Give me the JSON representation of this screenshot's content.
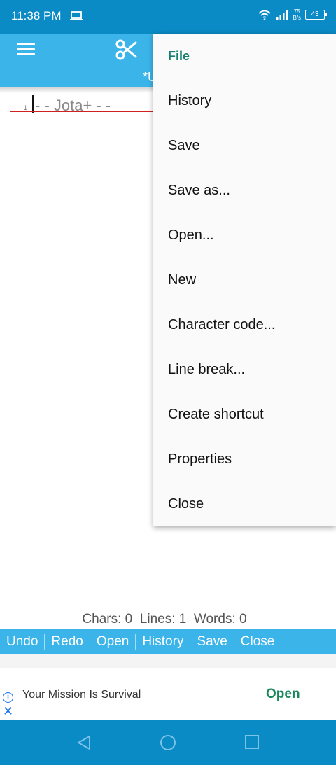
{
  "status_bar": {
    "time": "11:38 PM",
    "net_speed_value": "75",
    "net_speed_unit": "B/s",
    "battery": "43",
    "icons": [
      "laptop-icon",
      "wifi-icon",
      "signal-icon",
      "battery-icon"
    ]
  },
  "toolbar": {
    "doc_title": "*U",
    "icons": [
      "menu-icon",
      "scissors-icon"
    ]
  },
  "editor": {
    "line_number": "1",
    "line_text": "- - Jota+ - -"
  },
  "menu": {
    "header": "File",
    "items": [
      "History",
      "Save",
      "Save as...",
      "Open...",
      "New",
      "Character code...",
      "Line break...",
      "Create shortcut",
      "Properties",
      "Close"
    ]
  },
  "stats": {
    "text": "Chars: 0  Lines: 1  Words: 0"
  },
  "function_bar": {
    "buttons": [
      "Undo",
      "Redo",
      "Open",
      "History",
      "Save",
      "Close"
    ]
  },
  "ad": {
    "text": "Your Mission Is Survival",
    "cta": "Open",
    "icons": [
      "info-icon",
      "close-icon"
    ]
  },
  "navigation": {
    "icons": [
      "back-icon",
      "home-icon",
      "recents-icon"
    ]
  },
  "colors": {
    "status_bar": "#0b8bc6",
    "app_bar": "#3bb4ea",
    "menu_header": "#167f73",
    "ad_cta": "#1a8a5e",
    "line_rule": "#d02020"
  }
}
